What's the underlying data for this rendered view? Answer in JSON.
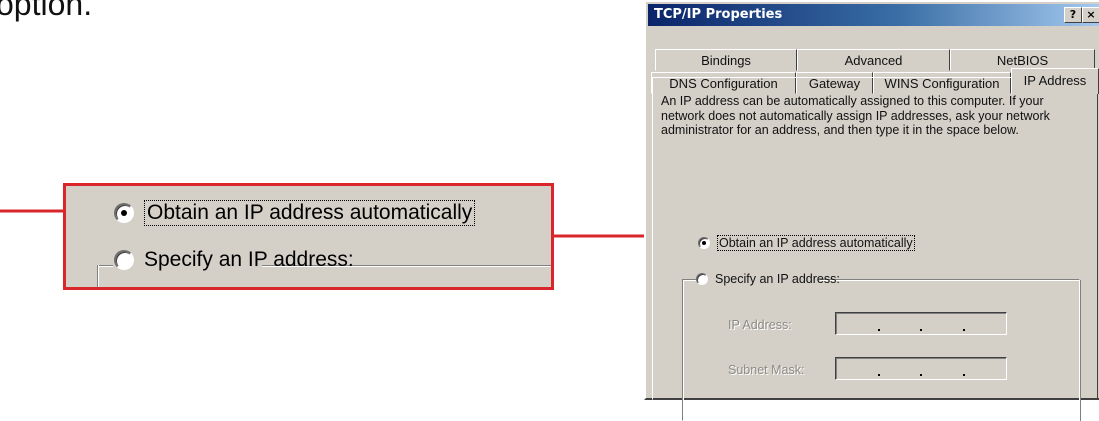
{
  "caption_fragment": "option.",
  "zoom": {
    "option_auto": "Obtain an IP address automatically",
    "option_specify": "Specify an IP address:"
  },
  "dialog": {
    "title": "TCP/IP Properties",
    "help_glyph": "?",
    "close_glyph": "×",
    "tabs_back": [
      "Bindings",
      "Advanced",
      "NetBIOS"
    ],
    "tabs_front": [
      "DNS Configuration",
      "Gateway",
      "WINS Configuration",
      "IP Address"
    ],
    "active_tab": "IP Address",
    "description": "An IP address can be automatically assigned to this computer. If your network does not automatically assign IP addresses, ask your network administrator for an address, and then type it in the space below.",
    "option_auto": "Obtain an IP address automatically",
    "option_specify": "Specify an IP address:",
    "ip_address_label": "IP Address:",
    "subnet_mask_label": "Subnet Mask:"
  },
  "colors": {
    "callout_red": "#d8262a",
    "dialog_face": "#d4d0c8",
    "title_blue": "#0a246a"
  }
}
